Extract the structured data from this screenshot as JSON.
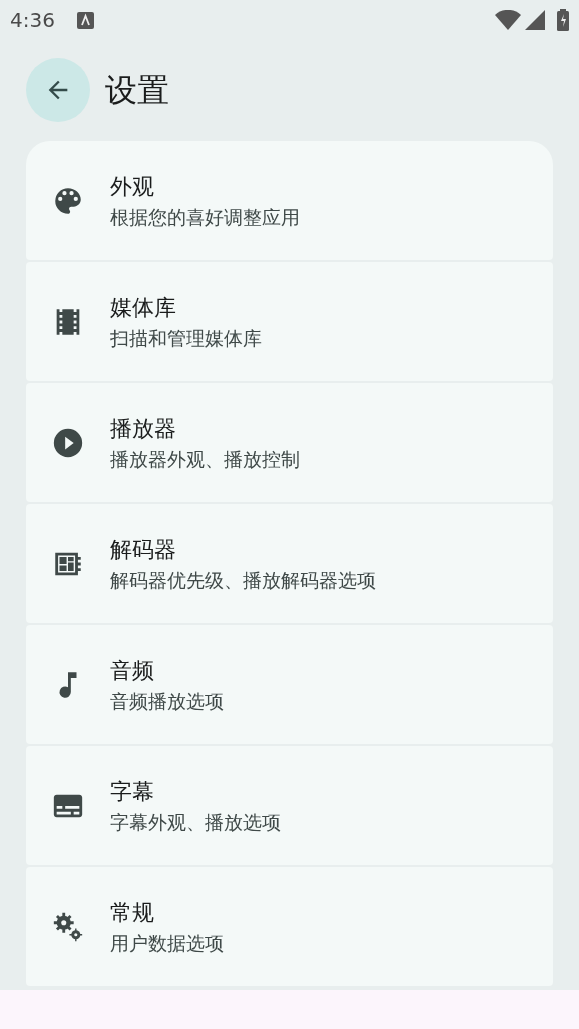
{
  "status_bar": {
    "time": "4:36"
  },
  "header": {
    "title": "设置"
  },
  "items": [
    {
      "title": "外观",
      "subtitle": "根据您的喜好调整应用"
    },
    {
      "title": "媒体库",
      "subtitle": "扫描和管理媒体库"
    },
    {
      "title": "播放器",
      "subtitle": "播放器外观、播放控制"
    },
    {
      "title": "解码器",
      "subtitle": "解码器优先级、播放解码器选项"
    },
    {
      "title": "音频",
      "subtitle": "音频播放选项"
    },
    {
      "title": "字幕",
      "subtitle": "字幕外观、播放选项"
    },
    {
      "title": "常规",
      "subtitle": "用户数据选项"
    }
  ]
}
